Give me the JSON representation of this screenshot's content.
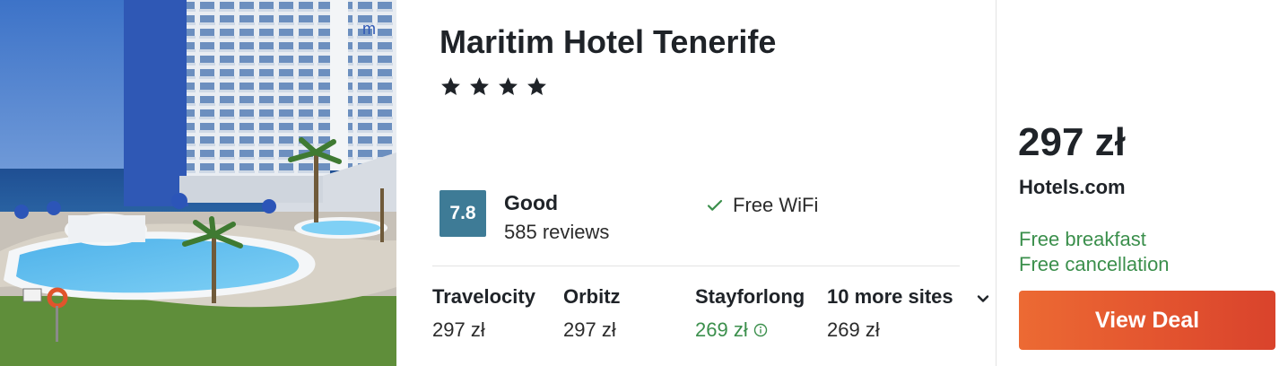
{
  "hotel": {
    "name": "Maritim Hotel Tenerife",
    "star_count": 4
  },
  "rating": {
    "score": "7.8",
    "label": "Good",
    "reviews": "585 reviews"
  },
  "amenity": {
    "label": "Free WiFi",
    "icon": "check-icon"
  },
  "sites": [
    {
      "name": "Travelocity",
      "price": "297 zł",
      "highlight": false
    },
    {
      "name": "Orbitz",
      "price": "297 zł",
      "highlight": false
    },
    {
      "name": "Stayforlong",
      "price": "269 zł",
      "highlight": true,
      "icon": "info-icon"
    },
    {
      "name": "10 more sites",
      "price": "269 zł",
      "highlight": false,
      "icon": "chevron-down-icon"
    }
  ],
  "deal": {
    "price": "297 zł",
    "provider": "Hotels.com",
    "perks": [
      "Free breakfast",
      "Free cancellation"
    ],
    "button_label": "View Deal"
  },
  "colors": {
    "rating_badge": "#3e7b96",
    "positive_text": "#3b8f4c",
    "button_start": "#ec6a33",
    "button_end": "#d9432c"
  }
}
